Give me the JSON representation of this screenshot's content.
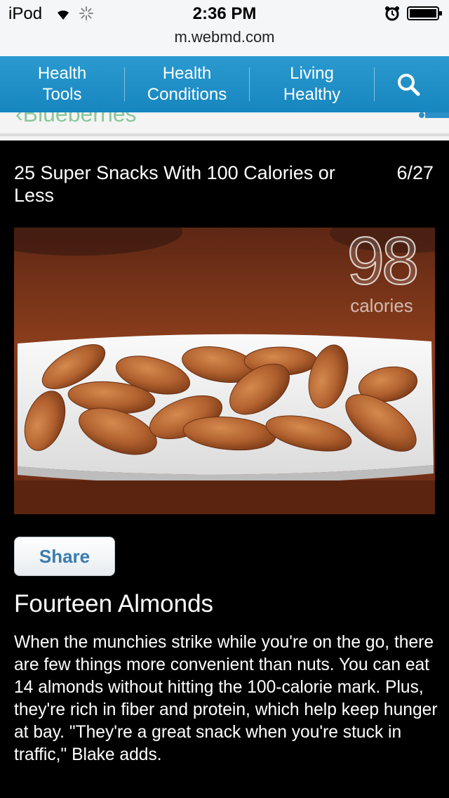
{
  "status_bar": {
    "carrier": "iPod",
    "time": "2:36 PM",
    "url": "m.webmd.com"
  },
  "nav": {
    "items": [
      {
        "label_line1": "Health",
        "label_line2": "Tools"
      },
      {
        "label_line1": "Health",
        "label_line2": "Conditions"
      },
      {
        "label_line1": "Living",
        "label_line2": "Healthy"
      }
    ],
    "search_icon": "search-icon"
  },
  "slide": {
    "title": "25 Super Snacks With 100 Calories or Less",
    "counter": "6/27",
    "calorie_number": "98",
    "calorie_label": "calories"
  },
  "share_label": "Share",
  "item": {
    "title": "Fourteen Almonds",
    "body": "When the munchies strike while you're on the go, there are few things more convenient than nuts. You can eat 14 almonds without hitting the 100-calorie mark. Plus, they're rich in fiber and protein, which help keep hunger at bay. \"They're a great snack when you're stuck in traffic,\" Blake adds."
  },
  "colors": {
    "nav_blue": "#1f90c8",
    "share_text": "#3a7cb0",
    "background": "#000000"
  }
}
